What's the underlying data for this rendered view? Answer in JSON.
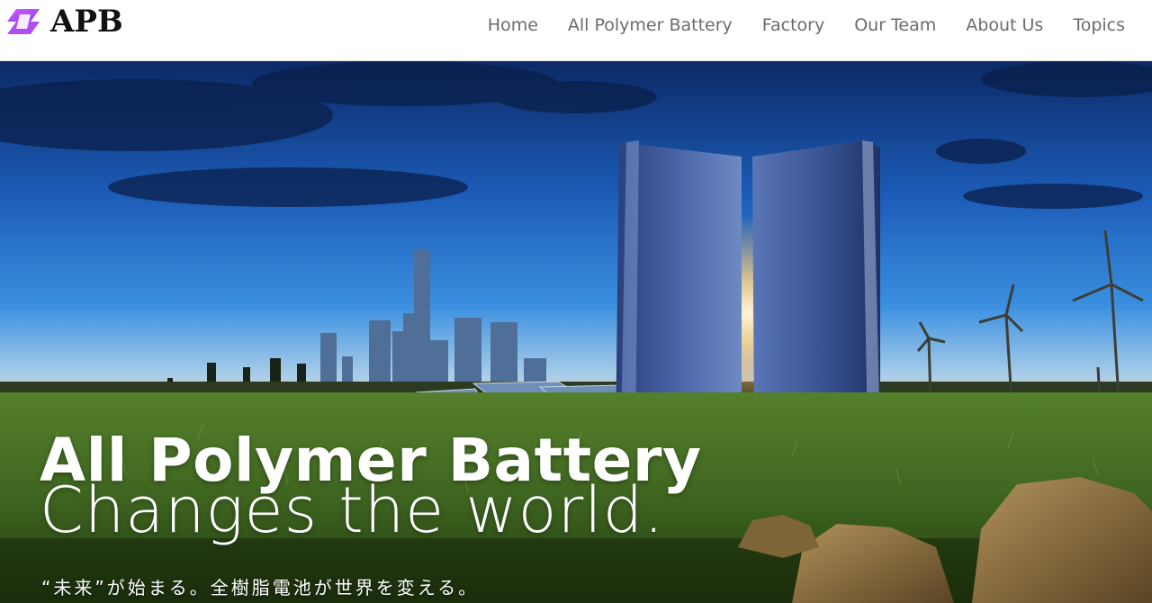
{
  "header": {
    "logo_text": "APB",
    "logo_colors": [
      "#c04cf0",
      "#7b3fe4"
    ],
    "nav": [
      {
        "label": "Home"
      },
      {
        "label": "All Polymer Battery"
      },
      {
        "label": "Factory"
      },
      {
        "label": "Our Team"
      },
      {
        "label": "About Us"
      },
      {
        "label": "Topics"
      }
    ]
  },
  "hero": {
    "title": "All Polymer Battery",
    "subtitle": "Changes the world.",
    "tagline": "“未来”が始まる。全樹脂電池が世界を変える。",
    "image_description_icons": [
      "city-skyline",
      "solar-panels",
      "twin-battery-towers",
      "wind-turbines",
      "electric-car",
      "rocks"
    ],
    "colors": {
      "sky_top": "#0d2f6b",
      "sky_mid": "#2a7fd6",
      "horizon": "#f3c48a",
      "grass": "#3f6a22",
      "text": "#ffffff"
    }
  }
}
